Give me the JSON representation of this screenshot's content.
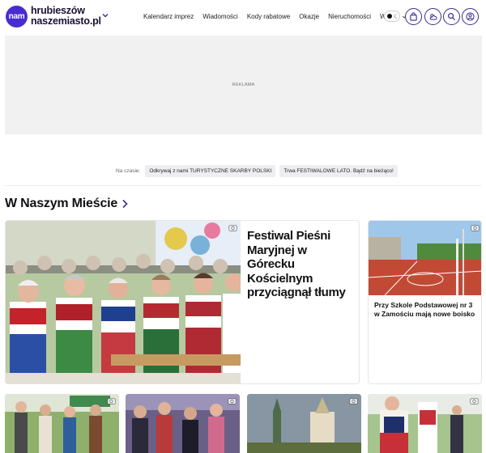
{
  "header": {
    "logo_mark": "nam",
    "logo_line1": "hrubieszów",
    "logo_line2": "naszemiasto.pl",
    "nav": [
      {
        "label": "Kalendarz imprez"
      },
      {
        "label": "Wiadomości"
      },
      {
        "label": "Kody rabatowe"
      },
      {
        "label": "Okazje"
      },
      {
        "label": "Nieruchomości"
      },
      {
        "label": "Więcej"
      }
    ],
    "icons": [
      "theme-toggle",
      "shopping-bag-icon",
      "weather-icon",
      "search-icon",
      "user-icon"
    ]
  },
  "ad": {
    "label": "REKLAMA"
  },
  "now": {
    "label": "Na czasie:",
    "topics": [
      "Odkrywaj z nami TURYSTYCZNE SKARBY POLSKI",
      "Trwa FESTIWALOWE LATO. Bądź na bieżąco!"
    ]
  },
  "section": {
    "title": "W Naszym Mieście"
  },
  "articles": {
    "main": {
      "title": "Festiwal Pieśni Maryjnej w Górecku Kościelnym przyciągnął tłumy"
    },
    "side": {
      "title": "Przy Szkole Podstawowej nr 3 w Zamościu mają nowe boisko"
    }
  },
  "colors": {
    "brand": "#4a2bd0",
    "icon_stroke": "#3a2a8a"
  }
}
